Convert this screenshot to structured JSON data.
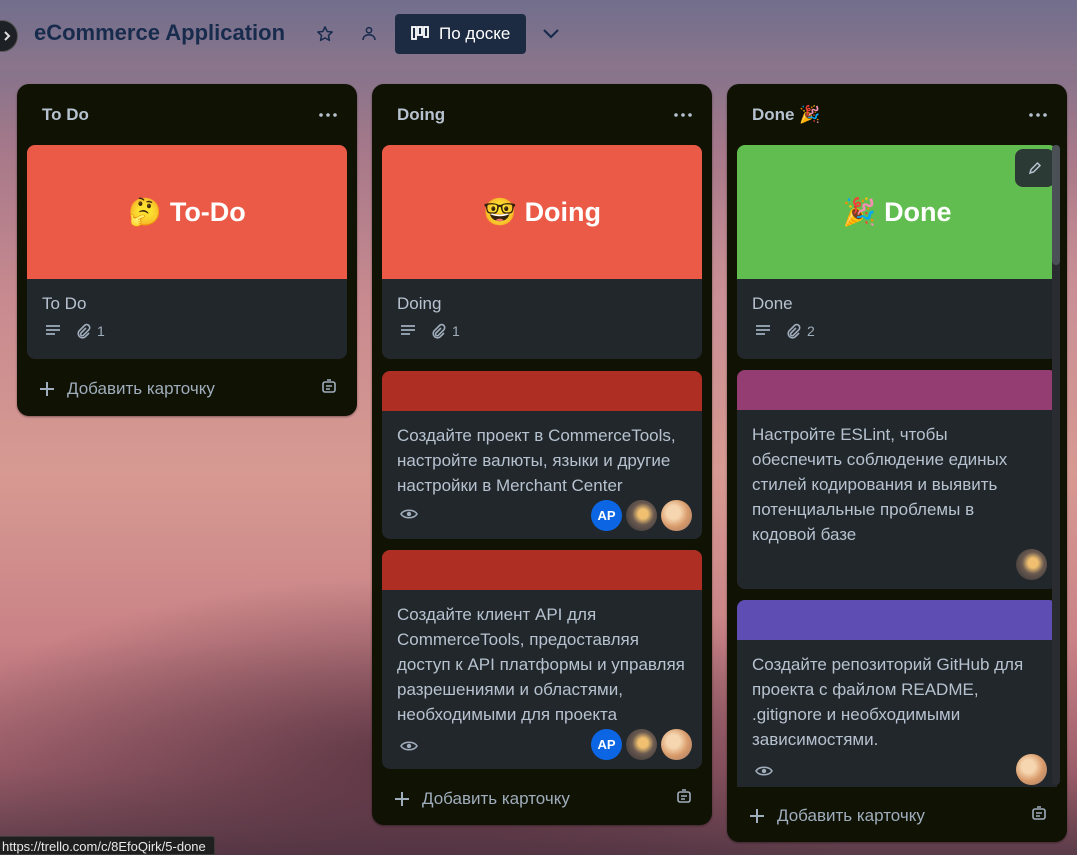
{
  "header": {
    "board_title": "eCommerce Application",
    "view_label": "По доске"
  },
  "lists": [
    {
      "name": "To Do",
      "cards": [
        {
          "cover_emoji": "🤔",
          "cover_text": "To-Do",
          "cover_color": "#eb5a46",
          "title": "To Do",
          "attachments": "1"
        }
      ],
      "add_label": "Добавить карточку"
    },
    {
      "name": "Doing",
      "cards": [
        {
          "cover_emoji": "🤓",
          "cover_text": "Doing",
          "cover_color": "#eb5a46",
          "title": "Doing",
          "attachments": "1"
        },
        {
          "cover_color": "#ae2e24",
          "title": "Создайте проект в CommerceTools, настройте валюты, языки и другие настройки в Merchant Center",
          "members": [
            "AP",
            "",
            ""
          ]
        },
        {
          "cover_color": "#ae2e24",
          "title": "Создайте клиент API для CommerceTools, предоставляя доступ к API платформы и управляя разрешениями и областями, необходимыми для проекта",
          "members": [
            "AP",
            "",
            ""
          ]
        }
      ],
      "add_label": "Добавить карточку"
    },
    {
      "name": "Done 🎉",
      "cards": [
        {
          "cover_emoji": "🎉",
          "cover_text": "Done",
          "cover_color": "#61bd4f",
          "title": "Done",
          "attachments": "2"
        },
        {
          "cover_color": "#943d73",
          "title": "Настройте ESLint, чтобы обеспечить соблюдение единых стилей кодирования и выявить потенциальные проблемы в кодовой базе"
        },
        {
          "cover_color": "#5e4db2",
          "title": "Создайте репозиторий GitHub для проекта с файлом README, .gitignore и необходимыми зависимостями."
        }
      ],
      "add_label": "Добавить карточку"
    }
  ],
  "status_bar": {
    "url": "https://trello.com/c/8EfoQirk/5-done"
  }
}
